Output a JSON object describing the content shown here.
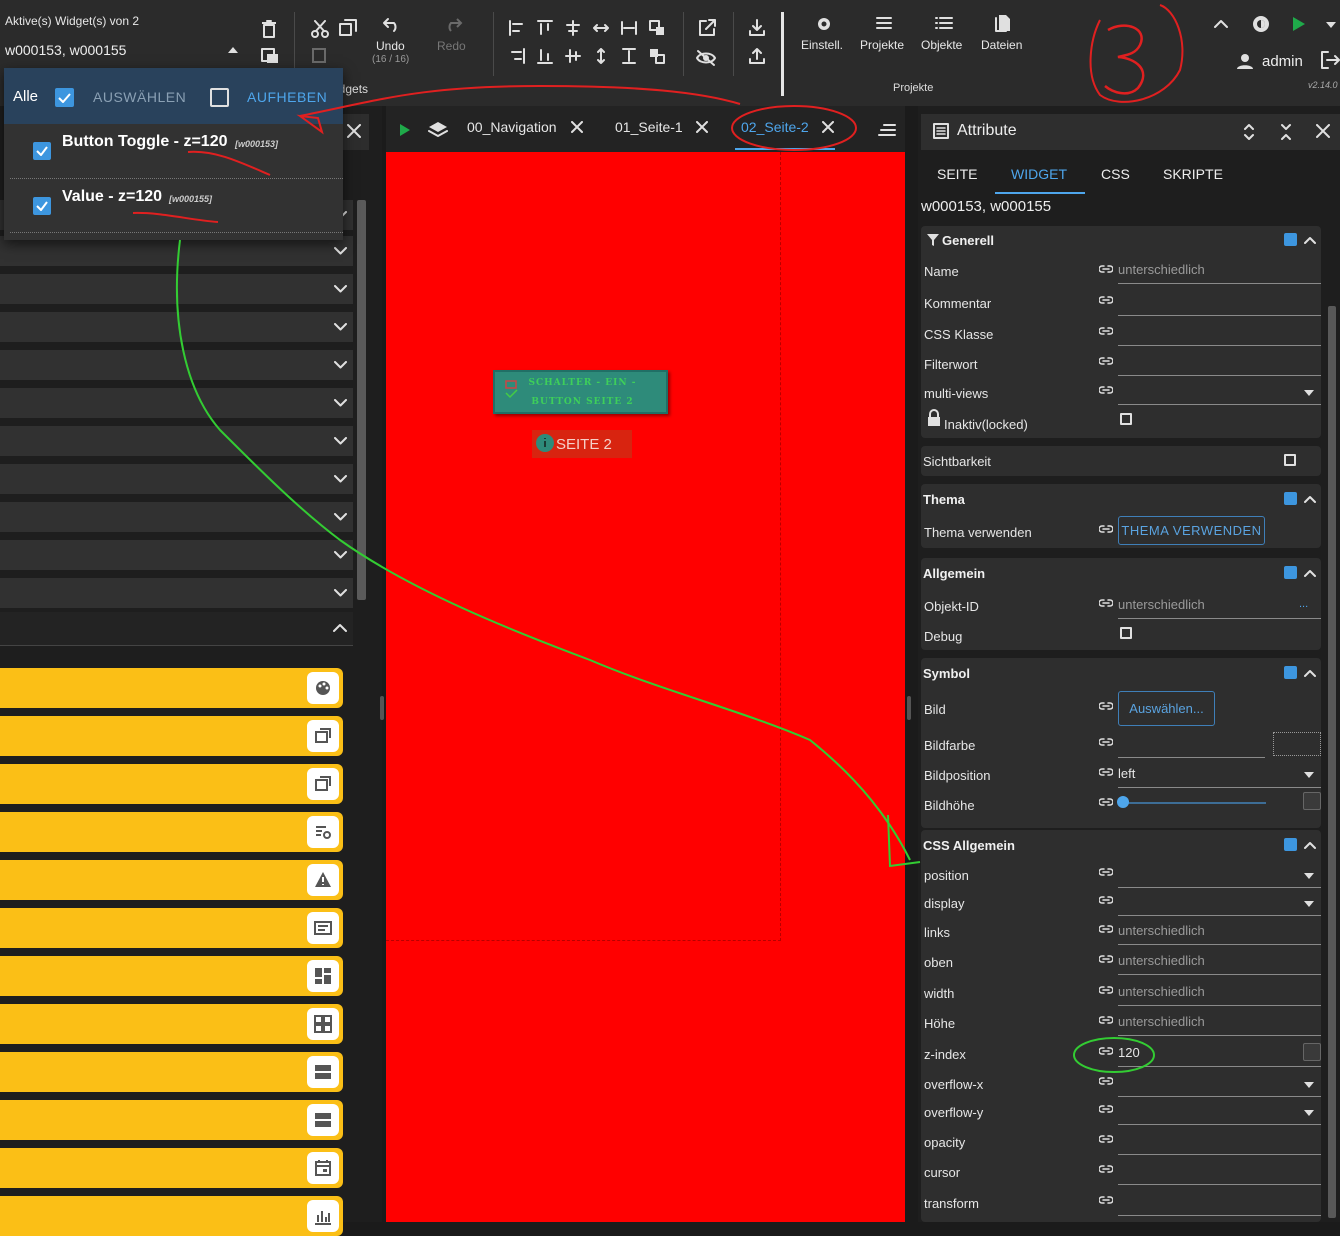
{
  "toolbar": {
    "active_label": "Aktive(s) Widget(s) von 2",
    "active_ids": "w000153, w000155",
    "undo_label": "Undo",
    "undo_count": "(16 / 16)",
    "redo_label": "Redo",
    "widgets_group": "idgets",
    "settings_label": "Einstell.",
    "projects_label": "Projekte",
    "objects_label": "Objekte",
    "files_label": "Dateien",
    "projects_group": "Projekte",
    "user": "admin",
    "version": "v2.14.0"
  },
  "popup": {
    "all_label": "Alle",
    "select_label": "AUSWÄHLEN",
    "unselect_label": "AUFHEBEN",
    "items": [
      {
        "name": "Button Toggle - z=120",
        "id": "[w000153]"
      },
      {
        "name": "Value - z=120",
        "id": "[w000155]"
      }
    ]
  },
  "tabs": [
    {
      "label": "00_Navigation"
    },
    {
      "label": "01_Seite-1"
    },
    {
      "label": "02_Seite-2",
      "active": true
    }
  ],
  "canvas": {
    "widget_button_line1": "Schalter - ein -",
    "widget_button_line2": "Button Seite 2",
    "widget_value": "SEITE 2",
    "background": "#ff0000"
  },
  "annotations": {
    "handwritten_number": "3"
  },
  "right": {
    "title": "Attribute",
    "tabs": [
      "SEITE",
      "WIDGET",
      "CSS",
      "SKRIPTE"
    ],
    "active_tab": "WIDGET",
    "selected": "w000153, w000155",
    "generell": {
      "title": "Generell",
      "name_label": "Name",
      "name_value": "unterschiedlich",
      "comment_label": "Kommentar",
      "css_class_label": "CSS Klasse",
      "filter_label": "Filterwort",
      "multiviews_label": "multi-views",
      "locked_label": "Inaktiv(locked)"
    },
    "sichtbarkeit": "Sichtbarkeit",
    "thema": {
      "title": "Thema",
      "use_label": "Thema verwenden",
      "button": "THEMA VERWENDEN"
    },
    "allgemein": {
      "title": "Allgemein",
      "objid_label": "Objekt-ID",
      "objid_value": "unterschiedlich",
      "objid_more": "...",
      "debug_label": "Debug"
    },
    "symbol": {
      "title": "Symbol",
      "bild_label": "Bild",
      "bild_button": "Auswählen...",
      "bildfarbe_label": "Bildfarbe",
      "bildposition_label": "Bildposition",
      "bildposition_value": "left",
      "bildhoehe_label": "Bildhöhe"
    },
    "css": {
      "title": "CSS Allgemein",
      "position_label": "position",
      "display_label": "display",
      "links_label": "links",
      "links_value": "unterschiedlich",
      "oben_label": "oben",
      "oben_value": "unterschiedlich",
      "width_label": "width",
      "width_value": "unterschiedlich",
      "hoehe_label": "Höhe",
      "hoehe_value": "unterschiedlich",
      "zindex_label": "z-index",
      "zindex_value": "120",
      "overflowx_label": "overflow-x",
      "overflowy_label": "overflow-y",
      "opacity_label": "opacity",
      "cursor_label": "cursor",
      "transform_label": "transform"
    }
  },
  "colors": {
    "accent": "#3d96df",
    "widget_yellow": "#fbbf16",
    "canvas_red": "#ff0000",
    "widget_teal": "#2e8b7a"
  }
}
